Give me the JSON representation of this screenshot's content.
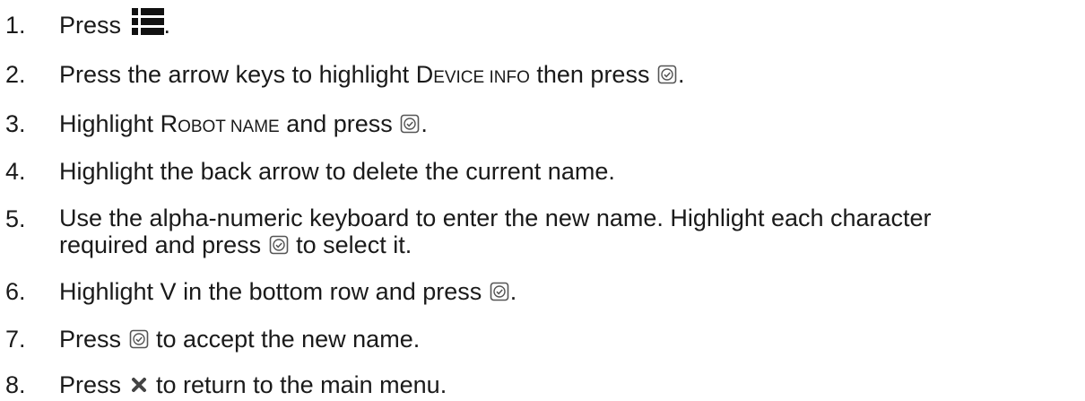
{
  "steps": [
    {
      "number": "1.",
      "before": "Press ",
      "after": "."
    },
    {
      "number": "2.",
      "before": "Press the arrow keys to highlight ",
      "sc_first": "D",
      "sc_rest": "EVICE INFO",
      "after": " then press ",
      "end": "."
    },
    {
      "number": "3.",
      "before": "Highlight ",
      "sc_first": "R",
      "sc_rest": "OBOT NAME",
      "after": " and press ",
      "end": "."
    },
    {
      "number": "4.",
      "text": "Highlight the back arrow to delete the current name."
    },
    {
      "number": "5.",
      "line1": "Use the alpha-numeric keyboard to enter the new name. Highlight each character",
      "line2_before": "required and press ",
      "line2_after": " to select it."
    },
    {
      "number": "6.",
      "before": "Highlight V in the bottom row and press ",
      "end": "."
    },
    {
      "number": "7.",
      "before": "Press ",
      "after": " to accept the new name."
    },
    {
      "number": "8.",
      "before": "Press ",
      "after": " to return to the main menu."
    }
  ],
  "icons": {
    "menu": "menu-list-icon",
    "select": "check-circle-icon",
    "close": "close-x-icon"
  }
}
